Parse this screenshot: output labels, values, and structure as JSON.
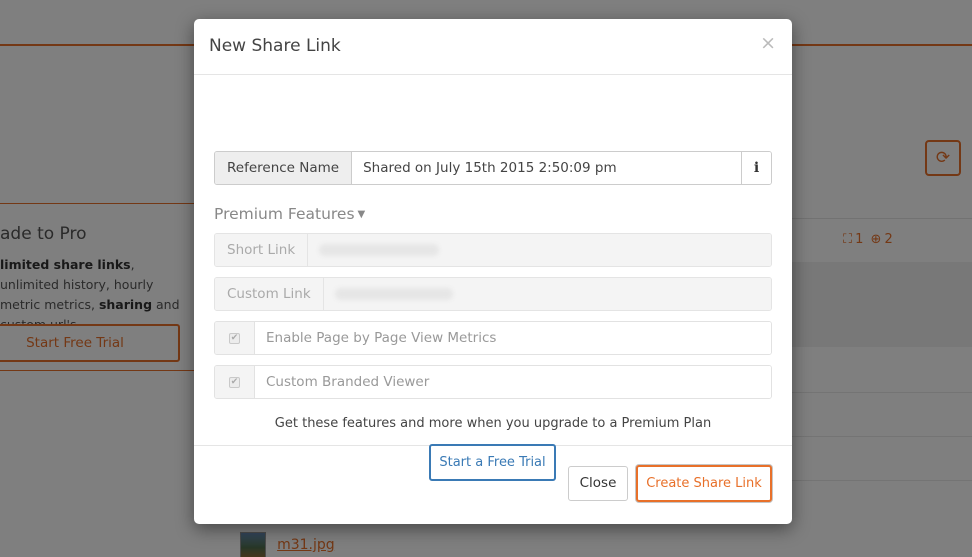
{
  "background": {
    "upgrade": {
      "title": "ade to Pro",
      "desc_bold1": "limited share links",
      "desc_text1": ", unlimited history, hourly metric metrics, ",
      "desc_bold2": "sharing",
      "desc_text2": " and custom url's.",
      "trial_button": "Start Free Trial"
    },
    "refresh_icon": "refresh-icon",
    "stats": {
      "views_icon": "binoculars-icon",
      "views": "1",
      "downloads_icon": "download-icon",
      "downloads": "2"
    },
    "file": {
      "name": "m31.jpg"
    }
  },
  "modal": {
    "title": "New Share Link",
    "close_glyph": "×",
    "reference": {
      "label": "Reference Name",
      "value": "Shared on July 15th 2015 2:50:09 pm",
      "info_glyph": "i"
    },
    "premium": {
      "toggle_label": "Premium Features",
      "caret": "▼",
      "short_link_label": "Short Link",
      "custom_link_label": "Custom Link",
      "metrics_label": "Enable Page by Page View Metrics",
      "branded_label": "Custom Branded Viewer",
      "check_glyph": "✔",
      "upgrade_text": "Get these features and more when you upgrade to a Premium Plan",
      "trial_button": "Start a Free Trial"
    },
    "footer": {
      "close_button": "Close",
      "create_button": "Create Share Link"
    }
  },
  "colors": {
    "accent": "#e8702a",
    "link_blue": "#3a7ab5",
    "backdrop": "rgba(0,0,0,0.5)"
  }
}
